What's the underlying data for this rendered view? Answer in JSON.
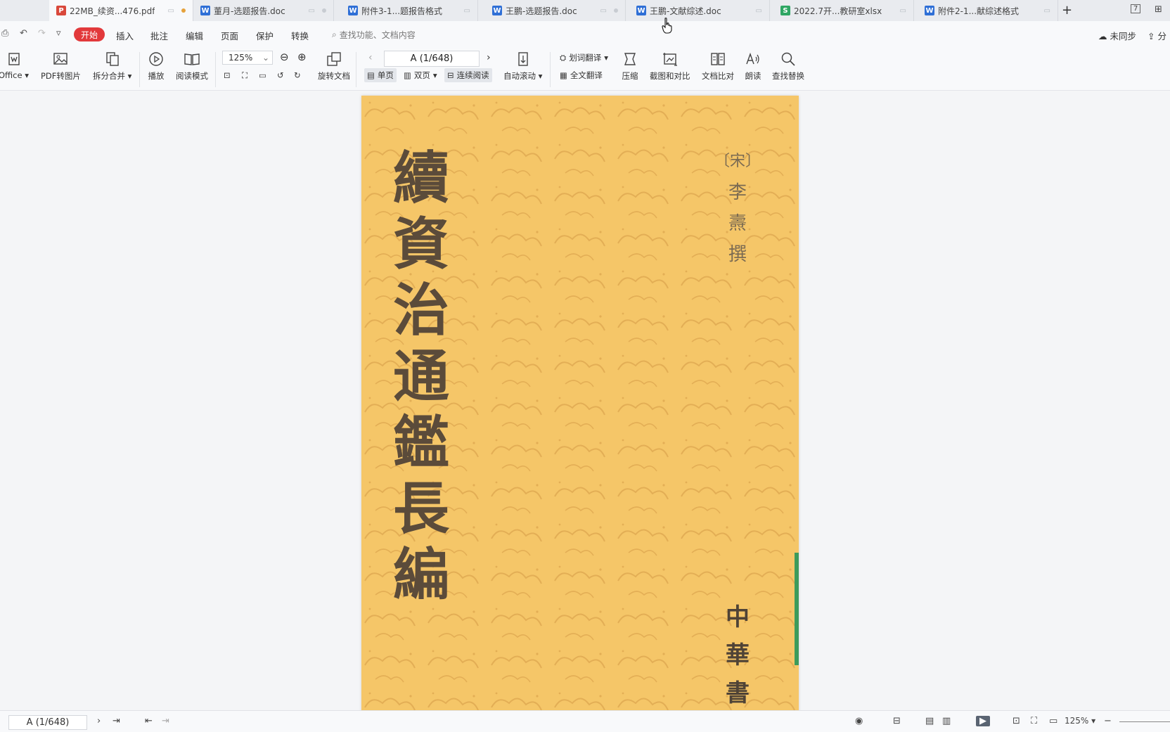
{
  "tabs": [
    {
      "label": "22MB_续资...476.pdf",
      "icon": "pdf-icon",
      "color": "#d9483b",
      "glyph": "P",
      "active": true
    },
    {
      "label": "董月-选题报告.doc",
      "icon": "word-icon",
      "color": "#2f6fd6",
      "glyph": "W"
    },
    {
      "label": "附件3-1...题报告格式",
      "icon": "word-icon",
      "color": "#2f6fd6",
      "glyph": "W"
    },
    {
      "label": "王鹏-选题报告.doc",
      "icon": "word-icon",
      "color": "#2f6fd6",
      "glyph": "W"
    },
    {
      "label": "王鹏-文献综述.doc",
      "icon": "word-icon",
      "color": "#2f6fd6",
      "glyph": "W"
    },
    {
      "label": "2022.7开...教研室xlsx",
      "icon": "sheet-icon",
      "color": "#2ea663",
      "glyph": "S"
    },
    {
      "label": "附件2-1...献综述格式",
      "icon": "word-icon",
      "color": "#2f6fd6",
      "glyph": "W"
    }
  ],
  "window": {
    "plus": "+",
    "badge": "7",
    "grid": "⊞"
  },
  "menu": {
    "start": "开始",
    "items": [
      "插入",
      "批注",
      "编辑",
      "页面",
      "保护",
      "转换"
    ],
    "search_placeholder": "查找功能、文档内容",
    "sync": "未同步",
    "share": "分"
  },
  "ribbon": {
    "office": "Office",
    "pdf_to_image": "PDF转图片",
    "split_merge": "拆分合并",
    "play": "播放",
    "read_mode": "阅读模式",
    "zoom": "125%",
    "rotate_doc": "旋转文档",
    "page": "A (1/648)",
    "single_page": "单页",
    "double_page": "双页",
    "continuous": "连续阅读",
    "auto_scroll": "自动滚动",
    "word_translate": "划词翻译",
    "full_translate": "全文翻译",
    "compress": "压缩",
    "screenshot_compare": "截图和对比",
    "doc_compare": "文档比对",
    "read_aloud": "朗读",
    "find_replace": "查找替换"
  },
  "document": {
    "title_chars": [
      "續",
      "資",
      "治",
      "通",
      "鑑",
      "長",
      "編"
    ],
    "author_chars": [
      "〔宋〕",
      "李",
      "燾",
      "撰"
    ],
    "publisher_chars": [
      "中",
      "華",
      "書"
    ],
    "cover_color": "#f5c668",
    "ink_color": "#5b4b3a"
  },
  "status": {
    "page": "A (1/648)",
    "zoom": "125%"
  }
}
